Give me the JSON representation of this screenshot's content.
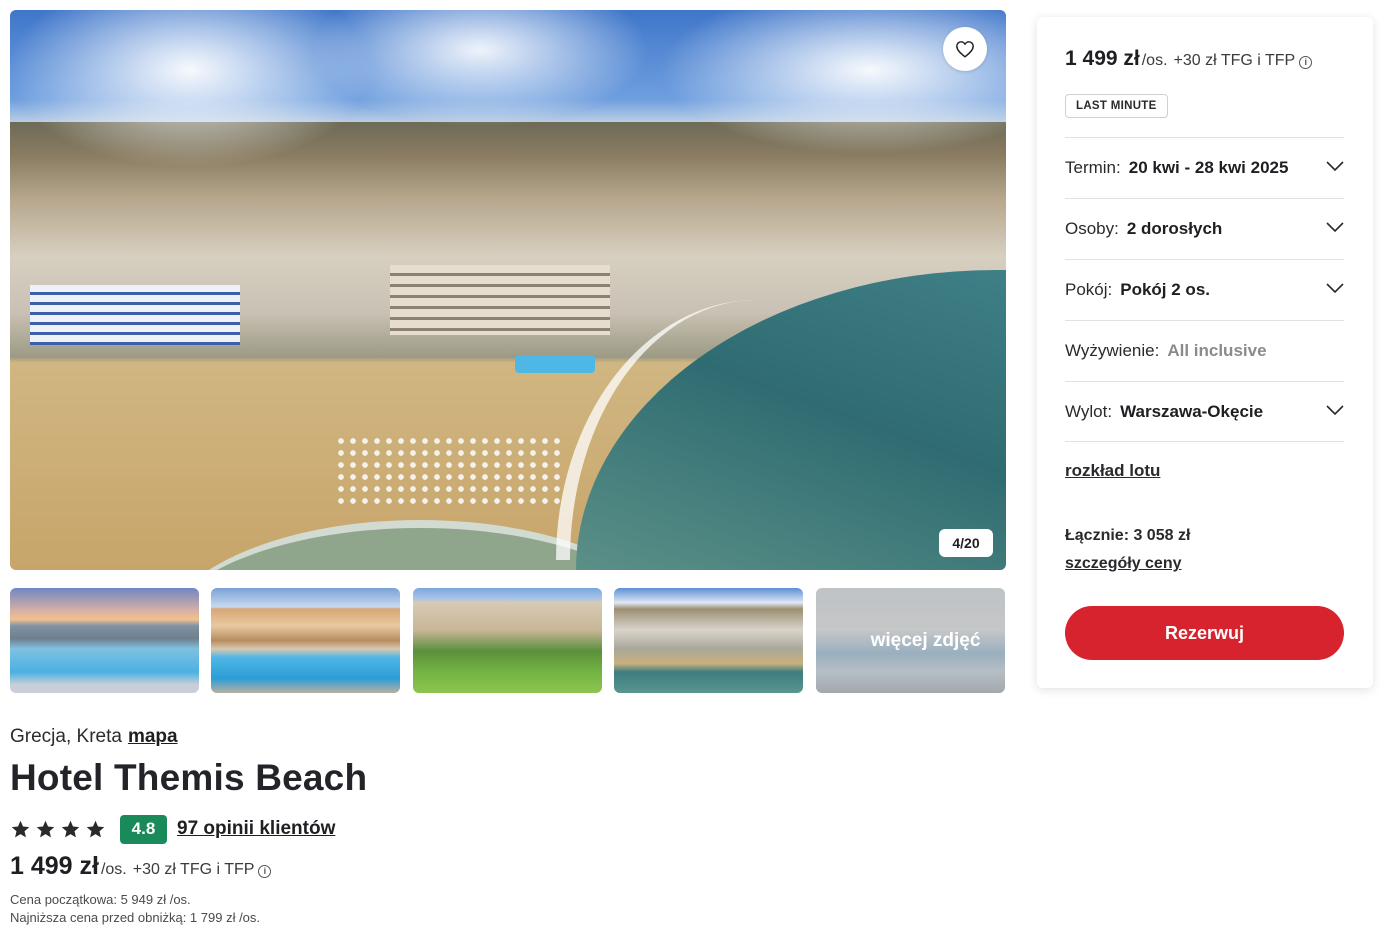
{
  "gallery": {
    "counter": "4/20",
    "favorite_icon": "heart-icon",
    "more_photos_label": "więcej zdjęć",
    "thumbnails": [
      "pool-sunset",
      "hotel-pool",
      "hotel-garden",
      "aerial-coast",
      "room-interior"
    ]
  },
  "hotel": {
    "location": "Grecja, Kreta",
    "map_link": "mapa",
    "name": "Hotel Themis Beach",
    "stars": 4,
    "score": "4.8",
    "score_color": "#1a8a5a",
    "reviews_link": "97 opinii klientów",
    "price": "1 499 zł",
    "price_unit": "/os.",
    "price_extra": "+30 zł TFG i TFP",
    "original_price_note": "Cena początkowa: 5 949 zł /os.",
    "lowest_price_note": "Najniższa cena przed obniżką: 1 799 zł /os."
  },
  "booking": {
    "price": "1 499 zł",
    "price_unit": "/os.",
    "price_extra": "+30 zł TFG i TFP",
    "badge": "LAST MINUTE",
    "options": [
      {
        "label": "Termin:",
        "value": "20 kwi - 28 kwi 2025"
      },
      {
        "label": "Osoby:",
        "value": "2 dorosłych"
      },
      {
        "label": "Pokój:",
        "value": "Pokój 2 os."
      },
      {
        "label": "Wyżywienie:",
        "value": "All inclusive"
      },
      {
        "label": "Wylot:",
        "value": "Warszawa-Okęcie"
      }
    ],
    "flight_schedule_link": "rozkład lotu",
    "total": "Łącznie: 3 058 zł",
    "price_details_link": "szczegóły ceny",
    "book_button": "Rezerwuj",
    "accent_color": "#d7232e"
  }
}
